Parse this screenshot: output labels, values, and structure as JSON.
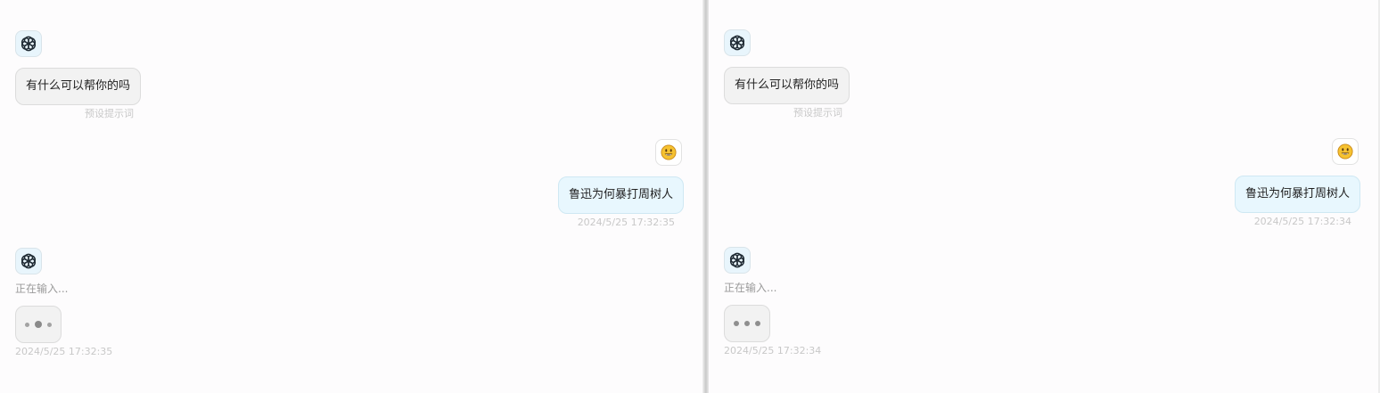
{
  "panes": [
    {
      "bot_greeting": {
        "text": "有什么可以帮你的吗",
        "meta": "预设提示词"
      },
      "user_message": {
        "text": "鲁迅为何暴打周树人",
        "time": "2024/5/25 17:32:35"
      },
      "bot_typing": {
        "label": "正在输入...",
        "time": "2024/5/25 17:32:35"
      }
    },
    {
      "bot_greeting": {
        "text": "有什么可以帮你的吗",
        "meta": "预设提示词"
      },
      "user_message": {
        "text": "鲁迅为何暴打周树人",
        "time": "2024/5/25 17:32:34"
      },
      "bot_typing": {
        "label": "正在输入...",
        "time": "2024/5/25 17:32:34"
      }
    }
  ],
  "icons": {
    "bot_avatar": "openai-logo-icon",
    "user_avatar": "smiley-emoji-icon"
  },
  "colors": {
    "bot_bubble": "#f2f2f2",
    "user_bubble": "#e8f7fe",
    "avatar_bg": "#e8f5fc",
    "meta_text": "#c8c8c8"
  }
}
